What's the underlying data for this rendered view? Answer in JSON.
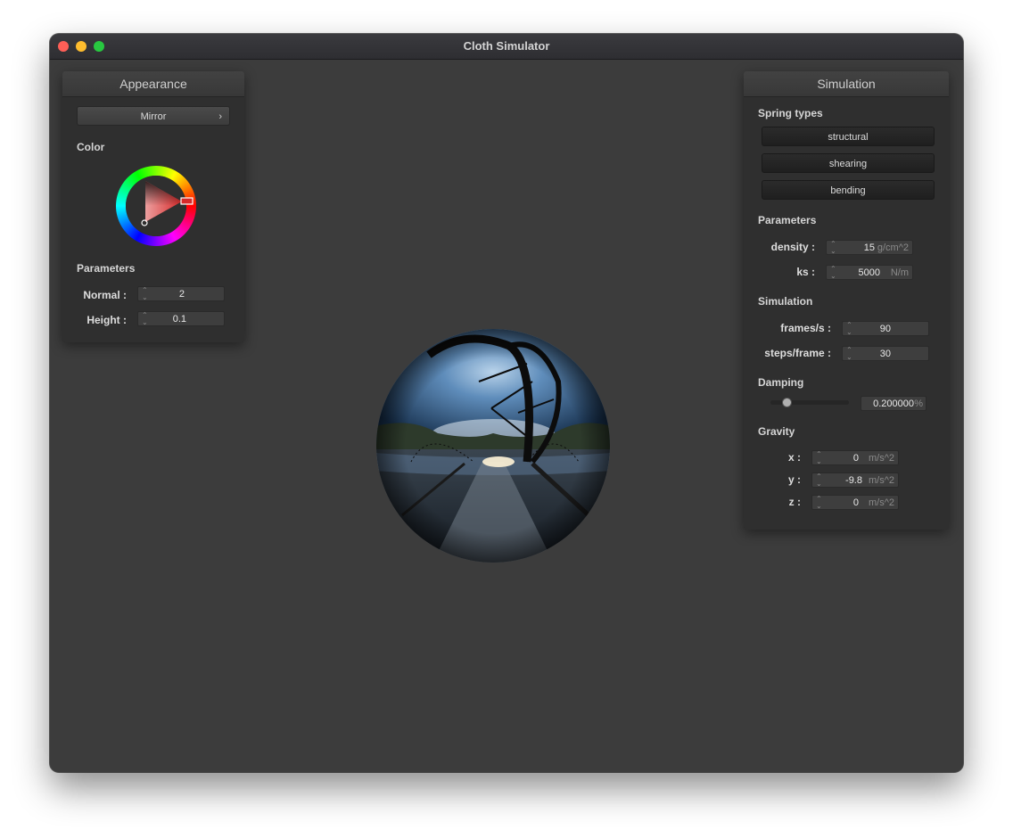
{
  "window": {
    "title": "Cloth Simulator"
  },
  "appearance": {
    "title": "Appearance",
    "shader_selected": "Mirror",
    "color_label": "Color",
    "color": "#d62a2a",
    "parameters_label": "Parameters",
    "normal_label": "Normal :",
    "normal_value": "2",
    "height_label": "Height :",
    "height_value": "0.1"
  },
  "simulation": {
    "title": "Simulation",
    "spring_types_label": "Spring types",
    "spring_types": [
      "structural",
      "shearing",
      "bending"
    ],
    "parameters_label": "Parameters",
    "density_label": "density :",
    "density_value": "15",
    "density_unit": "g/cm^2",
    "ks_label": "ks :",
    "ks_value": "5000",
    "ks_unit": "N/m",
    "simulation_label": "Simulation",
    "fps_label": "frames/s :",
    "fps_value": "90",
    "steps_label": "steps/frame :",
    "steps_value": "30",
    "damping_label": "Damping",
    "damping_value": "0.200000",
    "damping_unit": "%",
    "damping_fraction": 0.2,
    "gravity_label": "Gravity",
    "gravity_x_label": "x :",
    "gravity_x": "0",
    "gravity_y_label": "y :",
    "gravity_y": "-9.8",
    "gravity_z_label": "z :",
    "gravity_z": "0",
    "gravity_unit": "m/s^2"
  }
}
